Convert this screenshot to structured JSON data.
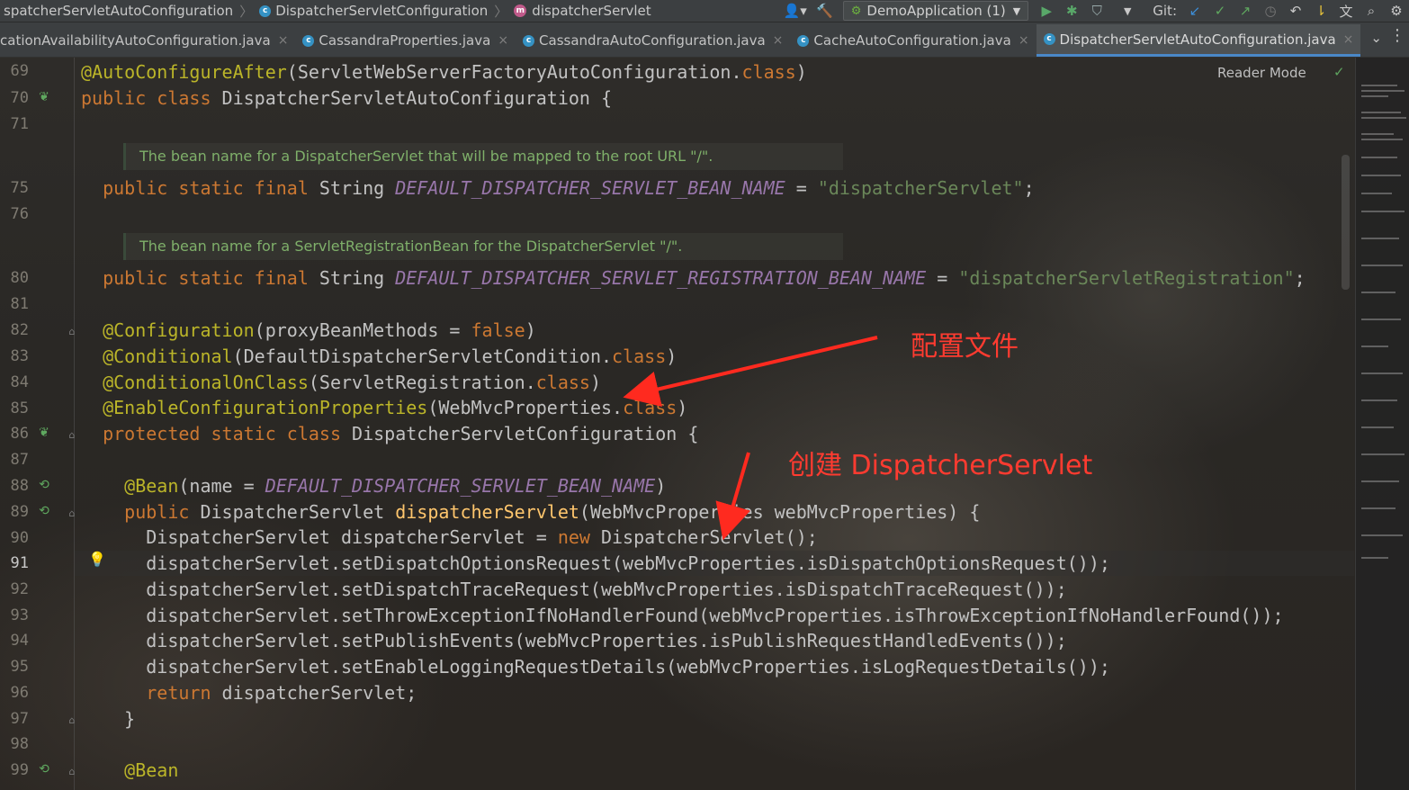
{
  "breadcrumbs": [
    {
      "label": "spatcherServletAutoConfiguration",
      "icon": "class-icon"
    },
    {
      "label": "DispatcherServletConfiguration",
      "icon": "class-icon"
    },
    {
      "label": "dispatcherServlet",
      "icon": "method-icon"
    }
  ],
  "toolbar": {
    "run_config": "DemoApplication (1)",
    "git_label": "Git:"
  },
  "tabs": [
    {
      "label": "cationAvailabilityAutoConfiguration.java",
      "active": false
    },
    {
      "label": "CassandraProperties.java",
      "active": false
    },
    {
      "label": "CassandraAutoConfiguration.java",
      "active": false
    },
    {
      "label": "CacheAutoConfiguration.java",
      "active": false
    },
    {
      "label": "DispatcherServletAutoConfiguration.java",
      "active": true
    }
  ],
  "editor": {
    "reader_mode": "Reader Mode",
    "line_numbers": [
      "69",
      "70",
      "71",
      "75",
      "76",
      "80",
      "81",
      "82",
      "83",
      "84",
      "85",
      "86",
      "87",
      "88",
      "89",
      "90",
      "91",
      "92",
      "93",
      "94",
      "95",
      "96",
      "97",
      "98",
      "99"
    ],
    "current_line": "91",
    "docs": [
      "The bean name for a DispatcherServlet that will be mapped to the root URL \"/\".",
      "The bean name for a ServletRegistrationBean for the DispatcherServlet \"/\"."
    ]
  },
  "callouts": {
    "config_file": "配置文件",
    "create_servlet": "创建 DispatcherServlet"
  }
}
